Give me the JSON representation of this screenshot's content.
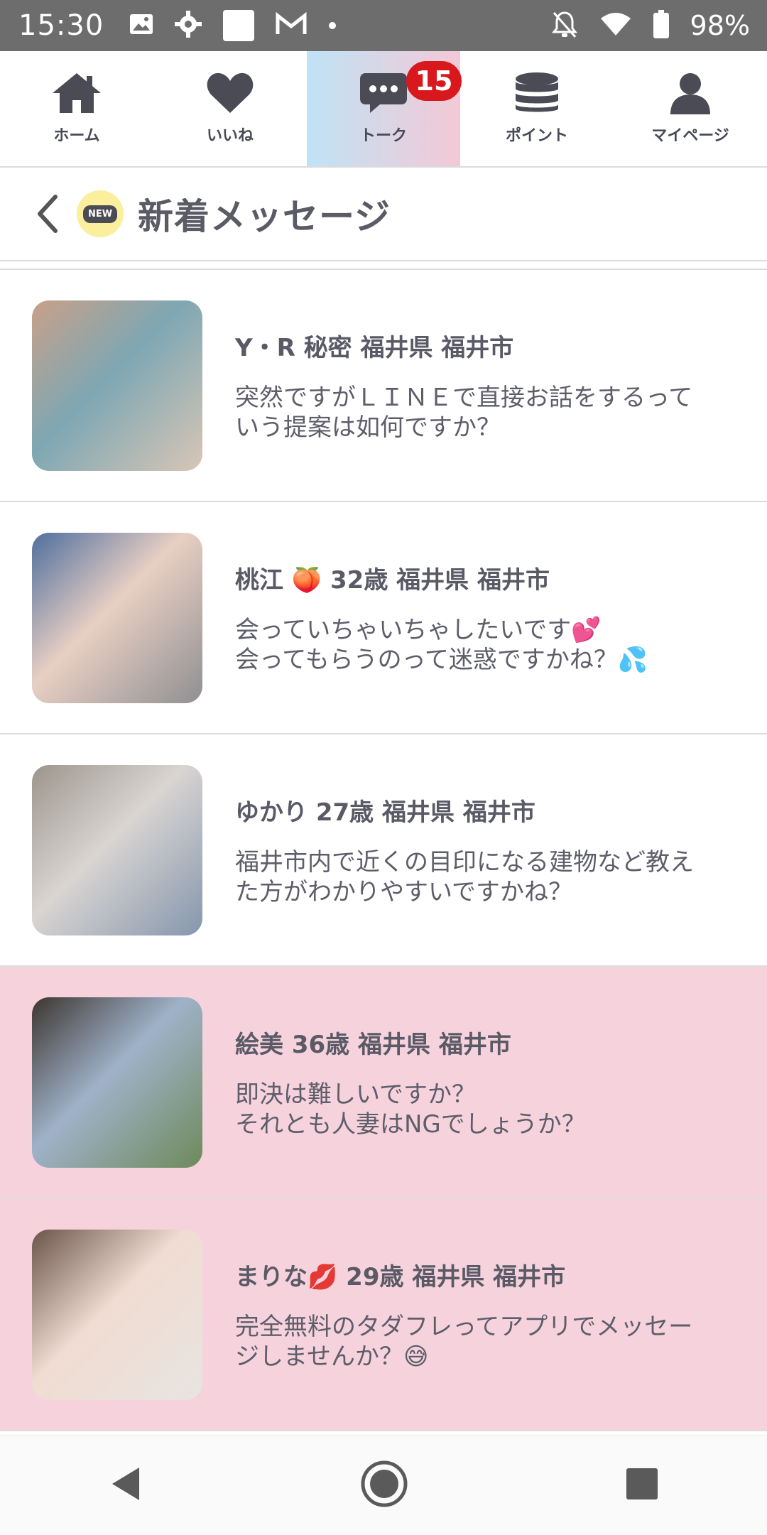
{
  "status_bar": {
    "time": "15:30",
    "battery": "98%",
    "icons": [
      "image-icon",
      "gear-icon",
      "app-thumbnail-icon",
      "gmail-icon",
      "dot-icon",
      "bell-off-icon",
      "wifi-icon",
      "battery-icon"
    ]
  },
  "nav": {
    "tabs": [
      {
        "label": "ホーム",
        "icon": "home-icon"
      },
      {
        "label": "いいね",
        "icon": "heart-icon"
      },
      {
        "label": "トーク",
        "icon": "chat-icon",
        "badge": "15",
        "active": true
      },
      {
        "label": "ポイント",
        "icon": "coins-icon"
      },
      {
        "label": "マイページ",
        "icon": "person-icon"
      }
    ]
  },
  "header": {
    "title": "新着メッセージ",
    "new_label": "NEW"
  },
  "messages": [
    {
      "name": "Y・R 秘密 福井県 福井市",
      "text": "突然ですがＬＩＮＥで直接お話をするって\nいう提案は如何ですか？",
      "highlight": false
    },
    {
      "name": "桃江 🍑 32歳 福井県 福井市",
      "text": "会っていちゃいちゃしたいです💕\n会ってもらうのって迷惑ですかね？💦",
      "highlight": false
    },
    {
      "name": "ゆかり 27歳 福井県 福井市",
      "text": "福井市内で近くの目印になる建物など教え\nた方がわかりやすいですかね？",
      "highlight": false
    },
    {
      "name": "絵美 36歳 福井県 福井市",
      "text": "即決は難しいですか？\nそれとも人妻はNGでしょうか？",
      "highlight": true
    },
    {
      "name": "まりな💋 29歳 福井県 福井市",
      "text": "完全無料のタダフレってアプリでメッセー\nジしませんか？😅",
      "highlight": true
    }
  ],
  "colors": {
    "status_bar": "#6d6d6d",
    "badge": "#d9181e",
    "highlight_row": "#f6d3dc",
    "new_icon_bg": "#fbee9c"
  }
}
